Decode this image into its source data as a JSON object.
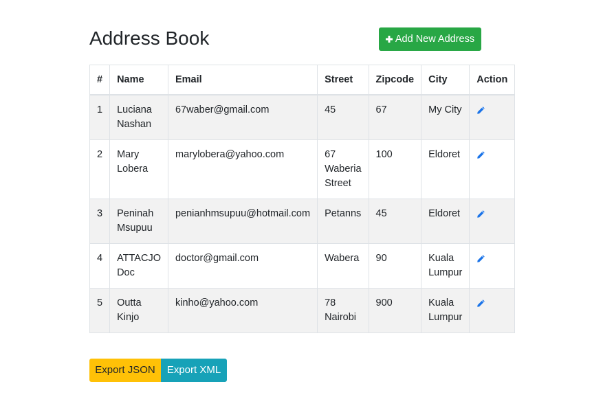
{
  "page": {
    "title": "Address Book"
  },
  "toolbar": {
    "add_label": "Add New Address",
    "add_icon": "plus-icon"
  },
  "table": {
    "headers": [
      "#",
      "Name",
      "Email",
      "Street",
      "Zipcode",
      "City",
      "Action"
    ],
    "rows": [
      {
        "num": "1",
        "name": "Luciana Nashan",
        "email": "67waber@gmail.com",
        "street": "45",
        "zipcode": "67",
        "city": "My City",
        "action_icon": "pencil-icon"
      },
      {
        "num": "2",
        "name": "Mary Lobera",
        "email": "marylobera@yahoo.com",
        "street": "67 Waberia Street",
        "zipcode": "100",
        "city": "Eldoret",
        "action_icon": "pencil-icon"
      },
      {
        "num": "3",
        "name": "Peninah Msupuu",
        "email": "penianhmsupuu@hotmail.com",
        "street": "Petanns",
        "zipcode": "45",
        "city": "Eldoret",
        "action_icon": "pencil-icon"
      },
      {
        "num": "4",
        "name": "ATTACJO Doc",
        "email": "doctor@gmail.com",
        "street": "Wabera",
        "zipcode": "90",
        "city": "Kuala Lumpur",
        "action_icon": "pencil-icon"
      },
      {
        "num": "5",
        "name": "Outta Kinjo",
        "email": "kinho@yahoo.com",
        "street": "78 Nairobi",
        "zipcode": "900",
        "city": "Kuala Lumpur",
        "action_icon": "pencil-icon"
      }
    ]
  },
  "export": {
    "json_label": "Export JSON",
    "xml_label": "Export XML"
  },
  "colors": {
    "add_button": "#28a745",
    "json_button": "#ffc107",
    "xml_button": "#17a2b8",
    "edit_icon": "#1a73e8",
    "striped_row": "#f2f2f2",
    "border": "#dee2e6"
  }
}
